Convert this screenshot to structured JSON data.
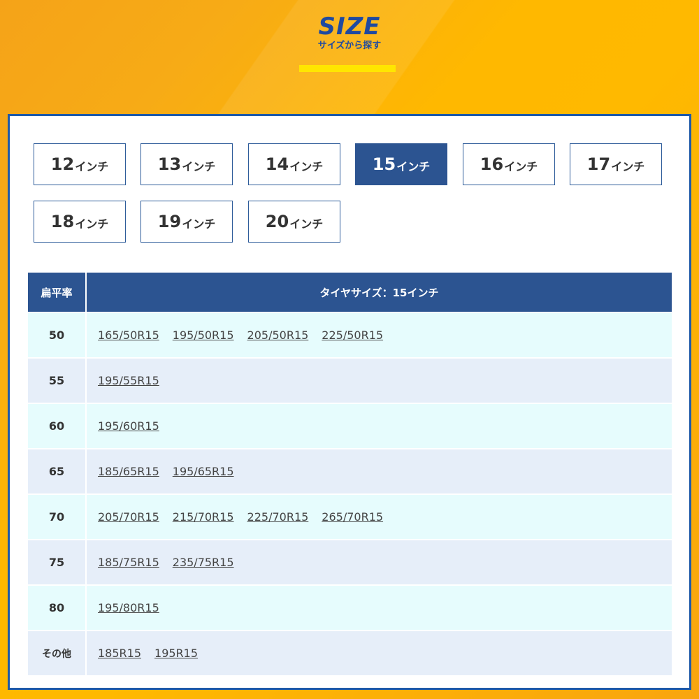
{
  "header": {
    "title": "SIZE",
    "subtitle": "サイズから探す"
  },
  "colors": {
    "accent_blue": "#2c5491",
    "title_blue": "#1f4aa0",
    "yellow_bar": "#ffe600",
    "background_orange": "#ffb800",
    "row_light_cyan": "#e6fcfd",
    "row_light_blue": "#e6eef9"
  },
  "tabs": [
    {
      "num": "12",
      "unit": "インチ",
      "active": false
    },
    {
      "num": "13",
      "unit": "インチ",
      "active": false
    },
    {
      "num": "14",
      "unit": "インチ",
      "active": false
    },
    {
      "num": "15",
      "unit": "インチ",
      "active": true
    },
    {
      "num": "16",
      "unit": "インチ",
      "active": false
    },
    {
      "num": "17",
      "unit": "インチ",
      "active": false
    },
    {
      "num": "18",
      "unit": "インチ",
      "active": false
    },
    {
      "num": "19",
      "unit": "インチ",
      "active": false
    },
    {
      "num": "20",
      "unit": "インチ",
      "active": false
    }
  ],
  "table": {
    "header_rate": "扁平率",
    "header_sizes": "タイヤサイズ：15インチ",
    "rows": [
      {
        "rate": "50",
        "sizes": [
          "165/50R15",
          "195/50R15",
          "205/50R15",
          "225/50R15"
        ]
      },
      {
        "rate": "55",
        "sizes": [
          "195/55R15"
        ]
      },
      {
        "rate": "60",
        "sizes": [
          "195/60R15"
        ]
      },
      {
        "rate": "65",
        "sizes": [
          "185/65R15",
          "195/65R15"
        ]
      },
      {
        "rate": "70",
        "sizes": [
          "205/70R15",
          "215/70R15",
          "225/70R15",
          "265/70R15"
        ]
      },
      {
        "rate": "75",
        "sizes": [
          "185/75R15",
          "235/75R15"
        ]
      },
      {
        "rate": "80",
        "sizes": [
          "195/80R15"
        ]
      },
      {
        "rate": "その他",
        "sizes": [
          "185R15",
          "195R15"
        ]
      }
    ]
  }
}
